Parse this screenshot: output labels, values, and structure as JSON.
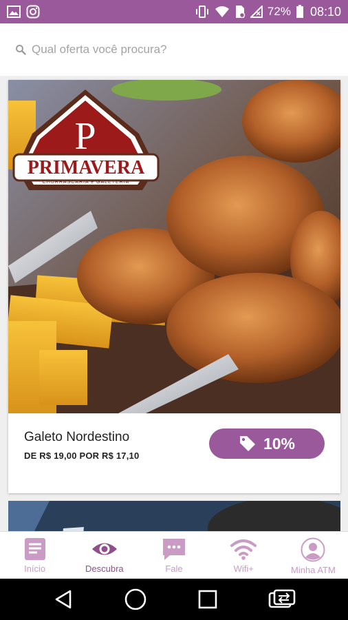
{
  "status_bar": {
    "battery_percent": "72%",
    "time": "08:10",
    "background_color": "#9a599a"
  },
  "search": {
    "placeholder": "Qual oferta você procura?",
    "icon": "search-icon"
  },
  "offer": {
    "brand_name": "PRIMAVERA",
    "brand_tagline": "CHURRASCARIA e GALETERIA",
    "brand_monogram": "P",
    "title": "Galeto Nordestino",
    "price_text": "DE R$ 19,00 POR R$ 17,10",
    "discount": "10%",
    "accent_color": "#9a599a"
  },
  "bottom_nav": {
    "items": [
      {
        "label": "Início",
        "icon": "document-icon",
        "active": false
      },
      {
        "label": "Descubra",
        "icon": "eye-icon",
        "active": true
      },
      {
        "label": "Fale",
        "icon": "chat-bubble-icon",
        "active": false
      },
      {
        "label": "Wifi+",
        "icon": "wifi-icon",
        "active": false
      },
      {
        "label": "Minha ATM",
        "icon": "user-icon",
        "active": false
      }
    ]
  }
}
